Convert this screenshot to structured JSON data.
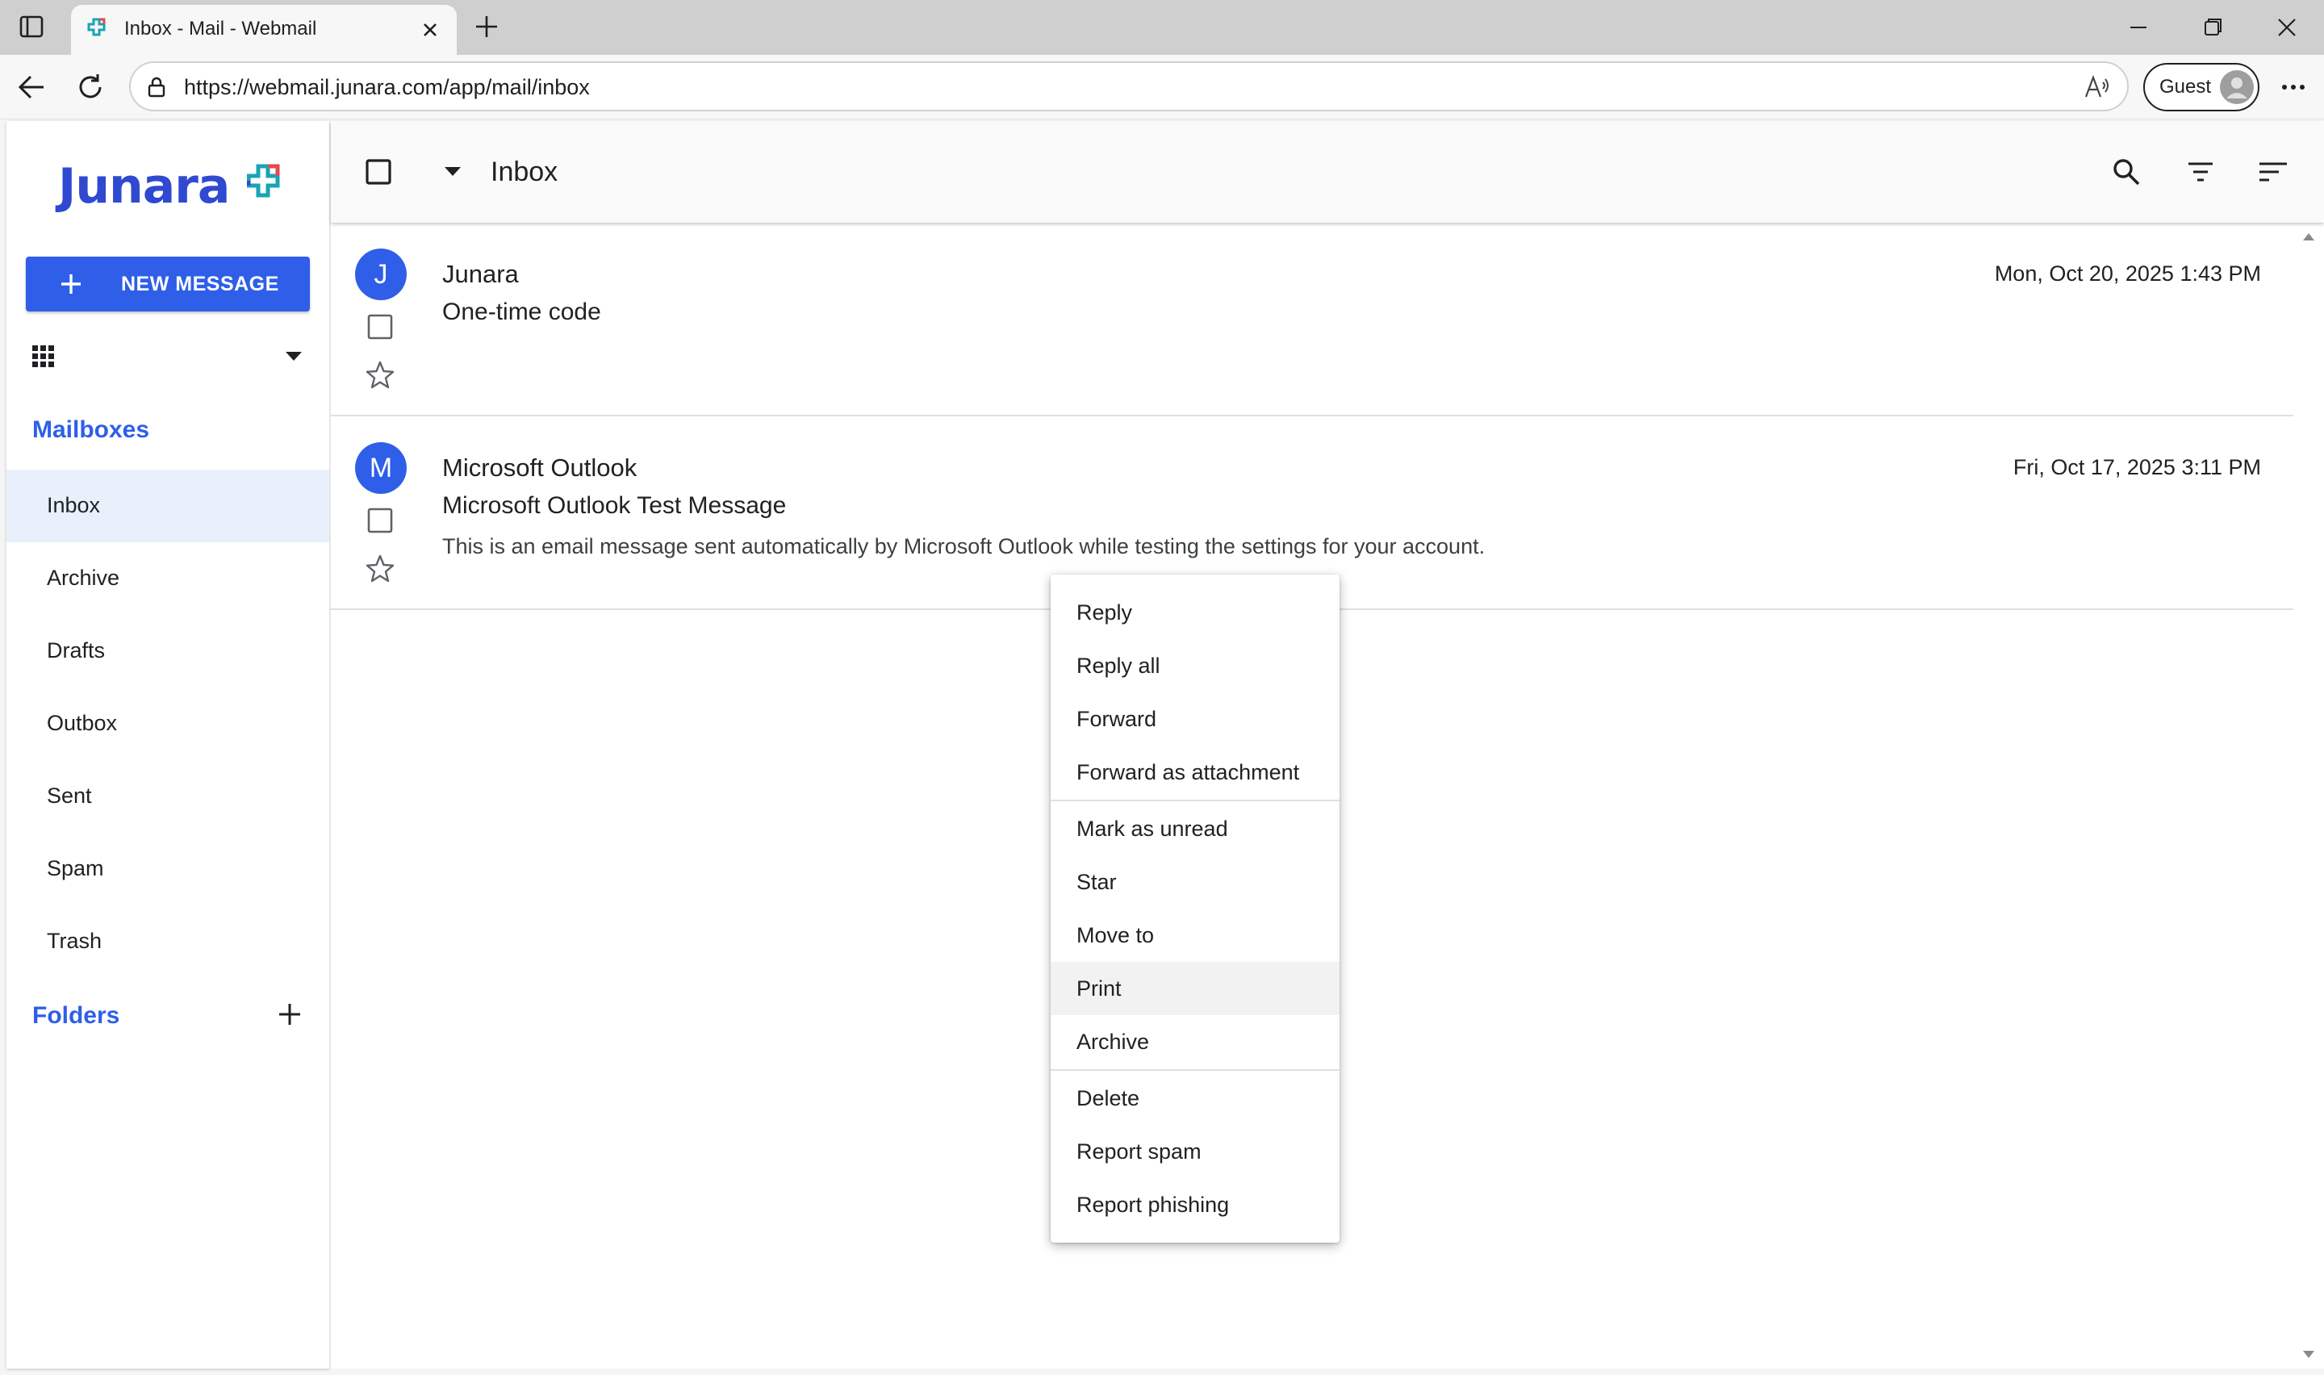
{
  "browser": {
    "tab_title": "Inbox - Mail - Webmail",
    "url": "https://webmail.junara.com/app/mail/inbox",
    "profile_label": "Guest"
  },
  "sidebar": {
    "logo_text": "Junara",
    "new_message_label": "NEW MESSAGE",
    "mailboxes_title": "Mailboxes",
    "folders_title": "Folders",
    "items": [
      {
        "label": "Inbox",
        "active": true
      },
      {
        "label": "Archive"
      },
      {
        "label": "Drafts"
      },
      {
        "label": "Outbox"
      },
      {
        "label": "Sent"
      },
      {
        "label": "Spam"
      },
      {
        "label": "Trash"
      }
    ]
  },
  "toolbar": {
    "title": "Inbox"
  },
  "messages": [
    {
      "avatar": "J",
      "sender": "Junara",
      "subject": "One-time code",
      "preview": "",
      "date": "Mon, Oct 20, 2025 1:43 PM"
    },
    {
      "avatar": "M",
      "sender": "Microsoft Outlook",
      "subject": "Microsoft Outlook Test Message",
      "preview": "This is an email message sent automatically by Microsoft Outlook while testing the settings for your account.",
      "date": "Fri, Oct 17, 2025 3:11 PM"
    }
  ],
  "context_menu": {
    "groups": [
      [
        "Reply",
        "Reply all",
        "Forward",
        "Forward as attachment"
      ],
      [
        "Mark as unread",
        "Star",
        "Move to",
        "Print",
        "Archive"
      ],
      [
        "Delete",
        "Report spam",
        "Report phishing"
      ]
    ],
    "hovered": "Print"
  },
  "colors": {
    "accent": "#2f5fe8",
    "active_nav_bg": "#e8f1fb",
    "tab_strip": "#cfcfcf"
  },
  "icons": [
    "tab-actions-icon",
    "junara-favicon",
    "close-icon",
    "plus-icon",
    "minimize-icon",
    "restore-icon",
    "back-icon",
    "reload-icon",
    "lock-icon",
    "read-aloud-icon",
    "profile-avatar-icon",
    "more-icon",
    "apps-grid-icon",
    "caret-down-icon",
    "checkbox-icon",
    "search-icon",
    "filter-icon",
    "sort-icon",
    "star-icon"
  ]
}
